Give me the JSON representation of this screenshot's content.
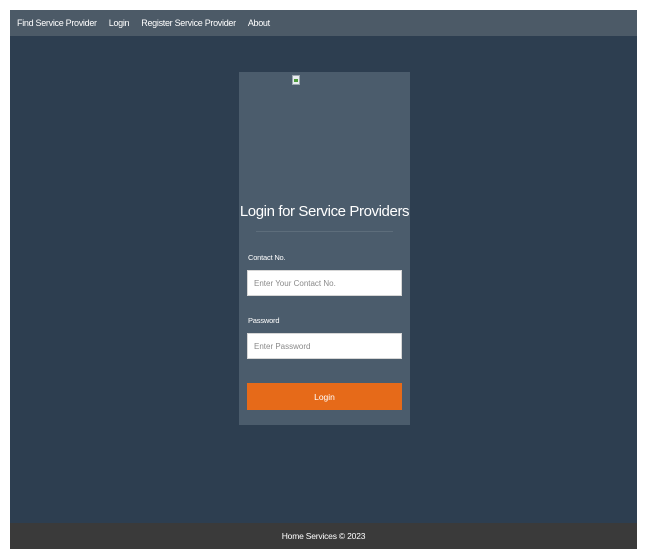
{
  "nav": {
    "items": [
      {
        "label": "Find Service Provider"
      },
      {
        "label": "Login"
      },
      {
        "label": "Register Service Provider"
      },
      {
        "label": "About"
      }
    ]
  },
  "login_card": {
    "title": "Login for Service Providers",
    "contact": {
      "label": "Contact No.",
      "placeholder": "Enter Your Contact No.",
      "value": ""
    },
    "password": {
      "label": "Password",
      "placeholder": "Enter Password",
      "value": ""
    },
    "submit_label": "Login"
  },
  "footer": {
    "text": "Home Services © 2023"
  },
  "colors": {
    "background": "#2d3e50",
    "navbar": "#4c5a67",
    "card": "#4b5c6c",
    "accent": "#e66a19",
    "footer": "#3a3a3a"
  }
}
